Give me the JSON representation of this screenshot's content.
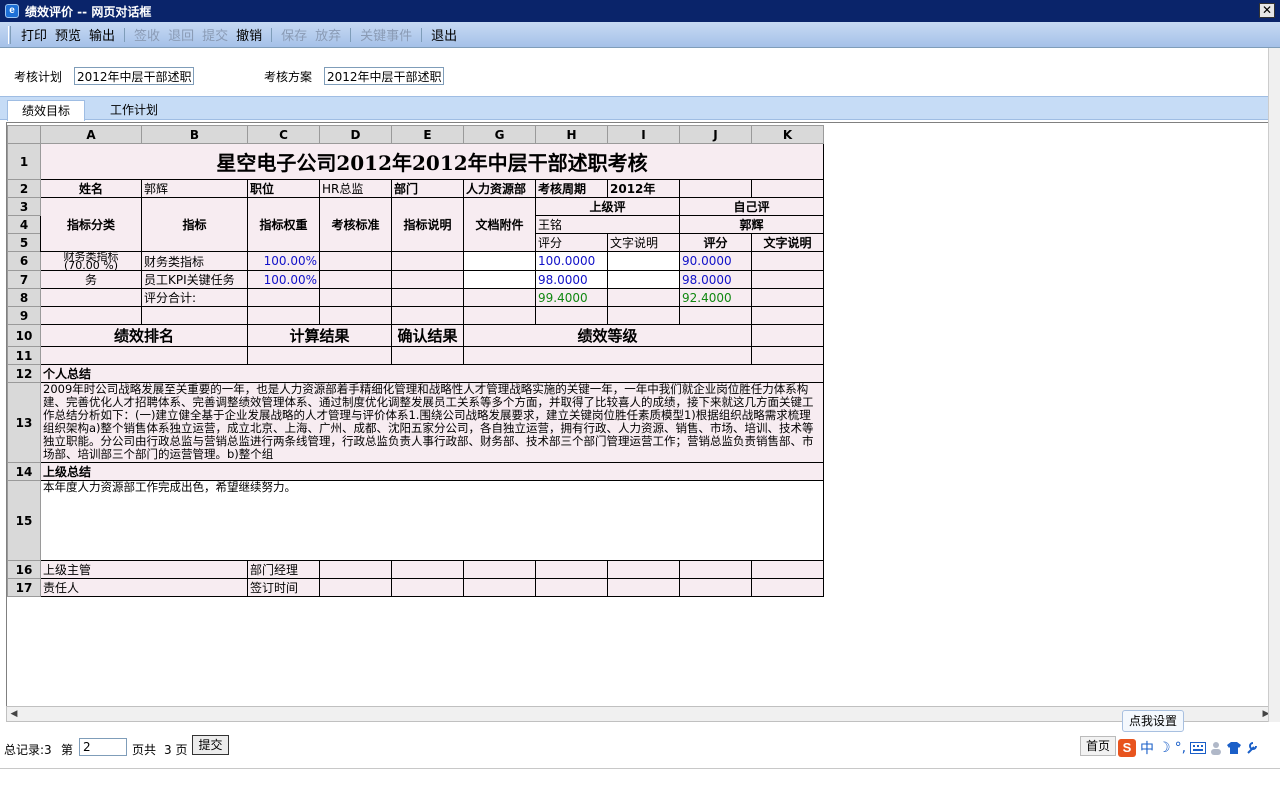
{
  "window": {
    "title": "绩效评价 -- 网页对话框",
    "close_glyph": "✕"
  },
  "toolbar": {
    "group1": [
      "打印",
      "预览",
      "输出"
    ],
    "group2": [
      "签收",
      "退回",
      "提交",
      "撤销"
    ],
    "group3": [
      "保存",
      "放弃"
    ],
    "group4": [
      "关键事件"
    ],
    "group5": [
      "退出"
    ]
  },
  "plan": {
    "plan_label": "考核计划",
    "plan_value": "2012年中层干部述职",
    "scheme_label": "考核方案",
    "scheme_value": "2012年中层干部述职"
  },
  "tabs": {
    "active": "绩效目标",
    "inactive": "工作计划"
  },
  "columns": [
    "A",
    "B",
    "C",
    "D",
    "E",
    "G",
    "H",
    "I",
    "J",
    "K"
  ],
  "rows": [
    "1",
    "2",
    "3",
    "4",
    "5",
    "6",
    "7",
    "8",
    "9",
    "10",
    "11",
    "12",
    "13",
    "14",
    "15",
    "16",
    "17"
  ],
  "sheet": {
    "title": "星空电子公司2012年2012年中层干部述职考核",
    "name_label": "姓名",
    "name_value": "郭辉",
    "position_label": "职位",
    "position_value": "HR总监",
    "dept_label": "部门",
    "dept_value": "人力资源部",
    "period_label": "考核周期",
    "period_value": "2012年",
    "cat_header": "指标分类",
    "indicator_header": "指标",
    "weight_header": "指标权重",
    "standard_header": "考核标准",
    "desc_header": "指标说明",
    "attach_header": "文档附件",
    "superior_eval": "上级评",
    "self_eval": "自己评",
    "superior_name": "王铭",
    "self_name": "郭辉",
    "score": "评分",
    "text_desc": "文字说明",
    "self_score": "评分",
    "self_text_desc": "文字说明",
    "r6_cat": "财务类指标",
    "r6_cat_sub": "(70.00 %)",
    "r6_indicator": "财务类指标",
    "r6_weight": "100.00%",
    "r6_sup_score": "100.0000",
    "r6_self_score": "90.0000",
    "r7_cat": "务",
    "r7_indicator": "员工KPI关键任务",
    "r7_weight": "100.00%",
    "r7_sup_score": "98.0000",
    "r7_self_score": "98.0000",
    "r8_label": "评分合计:",
    "r8_sup_total": "99.4000",
    "r8_self_total": "92.4000",
    "rank_header": "绩效排名",
    "calc_header": "计算结果",
    "confirm_header": "确认结果",
    "grade_header": "绩效等级",
    "personal_summary_label": "个人总结",
    "personal_summary": "2009年时公司战略发展至关重要的一年，也是人力资源部着手精细化管理和战略性人才管理战略实施的关键一年，一年中我们就企业岗位胜任力体系构建、完善优化人才招聘体系、完善调整绩效管理体系、通过制度优化调整发展员工关系等多个方面，并取得了比较喜人的成绩，接下来就这几方面关键工作总结分析如下：(一)建立健全基于企业发展战略的人才管理与评价体系1.围绕公司战略发展要求，建立关键岗位胜任素质模型1)根据组织战略需求梳理组织架构a)整个销售体系独立运营，成立北京、上海、广州、成都、沈阳五家分公司，各自独立运营，拥有行政、人力资源、销售、市场、培训、技术等独立职能。分公司由行政总监与营销总监进行两条线管理，行政总监负责人事行政部、财务部、技术部三个部门管理运营工作；营销总监负责销售部、市场部、培训部三个部门的运营管理。b)整个组",
    "superior_summary_label": "上级总结",
    "superior_summary": "本年度人力资源部工作完成出色，希望继续努力。",
    "r16_a": "上级主管",
    "r16_c": "部门经理",
    "r17_a": "责任人",
    "r17_c": "签订时间"
  },
  "status": {
    "total": "总记录:3",
    "page_prefix": "第",
    "page_value": "2",
    "page_suffix": "页共",
    "page_total": "3 页",
    "submit": "提交",
    "first": "首页"
  },
  "ime": {
    "tooltip": "点我设置",
    "logo": "S",
    "mode": "中",
    "moon": "☽",
    "dot": "°,"
  }
}
